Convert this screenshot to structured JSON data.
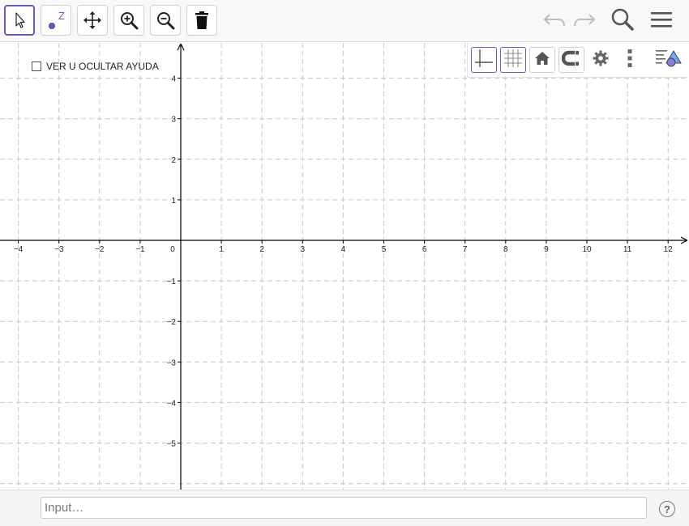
{
  "toolbar": {
    "tools": [
      {
        "name": "move-tool",
        "icon": "arrow-cursor-icon"
      },
      {
        "name": "point-tool",
        "icon": "point-icon"
      },
      {
        "name": "move-graphics-view-tool",
        "icon": "pan-arrows-icon"
      },
      {
        "name": "zoom-in-tool",
        "icon": "zoom-in-icon"
      },
      {
        "name": "zoom-out-tool",
        "icon": "zoom-out-icon"
      },
      {
        "name": "delete-tool",
        "icon": "trash-icon"
      }
    ],
    "point_label": "Z",
    "right": [
      "undo-icon",
      "redo-icon",
      "search-icon",
      "menu-icon"
    ]
  },
  "style_bar": {
    "buttons": [
      "axes-icon",
      "grid-icon",
      "home-icon",
      "magnet-icon",
      "gear-icon",
      "more-vert-icon",
      "style-panel-icon"
    ]
  },
  "checkbox": {
    "label": "VER U OCULTAR AYUDA",
    "checked": false
  },
  "input_bar": {
    "placeholder": "Input…",
    "help": "?"
  },
  "axes": {
    "x_ticks": [
      "−4",
      "−3",
      "−2",
      "−1",
      "0",
      "1",
      "2",
      "3",
      "4",
      "5",
      "6",
      "7",
      "8",
      "9",
      "10",
      "11",
      "12"
    ],
    "y_ticks_pos": [
      "4",
      "3",
      "2",
      "1"
    ],
    "y_ticks_neg": [
      "−1",
      "−2",
      "−3",
      "−4",
      "−5"
    ]
  },
  "colors": {
    "accent": "#6557d2",
    "grid": "#c8c8c8",
    "axis": "#000000"
  }
}
